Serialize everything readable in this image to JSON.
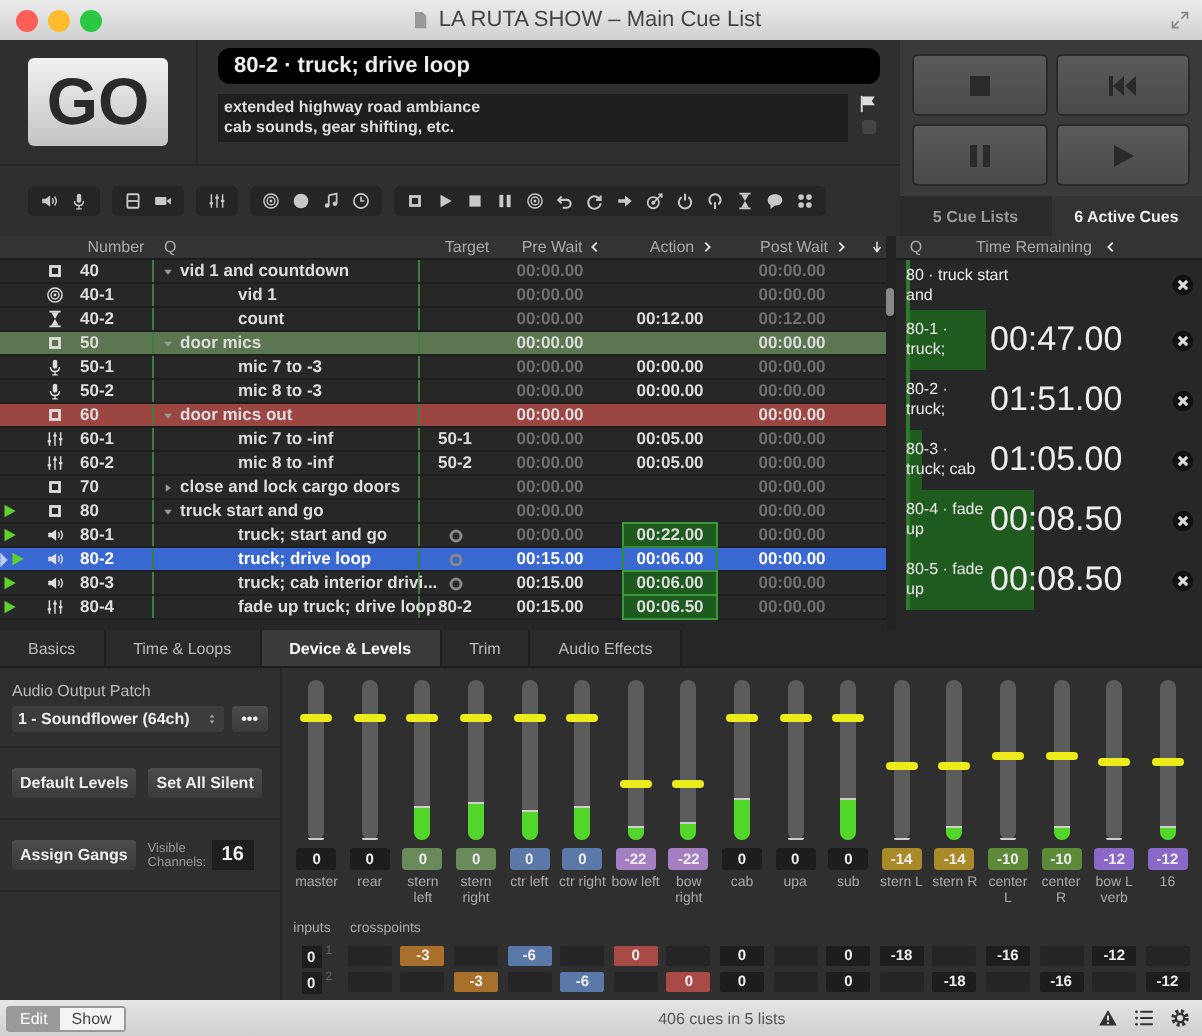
{
  "window": {
    "title": "LA RUTA SHOW – Main Cue List"
  },
  "go_button": {
    "label": "GO"
  },
  "current_cue": {
    "title": "80-2 · truck; drive loop",
    "notes": [
      "extended highway road ambiance",
      "cab sounds, gear shifting, etc."
    ]
  },
  "panel_tabs": [
    {
      "label": "5 Cue Lists",
      "selected": false
    },
    {
      "label": "6 Active Cues",
      "selected": true
    }
  ],
  "cue_list": {
    "columns": [
      "Number",
      "Q",
      "Target",
      "Pre Wait",
      "Action",
      "Post Wait"
    ],
    "cues": [
      {
        "number": "40",
        "kind": "group",
        "name": "vid 1 and countdown",
        "expanded": true,
        "selected": false,
        "running": false,
        "pre_wait": {
          "text": "00:00.00",
          "dim": true
        },
        "post_wait": {
          "text": "00:00.00",
          "dim": true
        },
        "children": [
          {
            "number": "40-1",
            "kind": "video",
            "name": "vid 1",
            "selected": false,
            "running": false,
            "pre_wait": {
              "text": "00:00.00",
              "dim": true
            },
            "post_wait": {
              "text": "00:00.00",
              "dim": true
            }
          },
          {
            "number": "40-2",
            "kind": "wait",
            "name": "count",
            "selected": false,
            "running": false,
            "pre_wait": {
              "text": "00:00.00",
              "dim": true
            },
            "action": {
              "text": "00:12.00",
              "dim": false
            },
            "post_wait": {
              "text": "00:12.00",
              "dim": true
            }
          }
        ]
      },
      {
        "number": "50",
        "kind": "group",
        "name": "door mics",
        "color": "#5b7650",
        "expanded": true,
        "selected": false,
        "running": false,
        "pre_wait": {
          "text": "00:00.00",
          "dim": false
        },
        "post_wait": {
          "text": "00:00.00",
          "dim": false
        },
        "children": [
          {
            "number": "50-1",
            "kind": "mic",
            "name": "mic 7 to -3",
            "selected": false,
            "running": false,
            "pre_wait": {
              "text": "00:00.00",
              "dim": true
            },
            "action": {
              "text": "00:00.00",
              "dim": false
            },
            "post_wait": {
              "text": "00:00.00",
              "dim": true
            }
          },
          {
            "number": "50-2",
            "kind": "mic",
            "name": "mic 8 to -3",
            "selected": false,
            "running": false,
            "pre_wait": {
              "text": "00:00.00",
              "dim": true
            },
            "action": {
              "text": "00:00.00",
              "dim": false
            },
            "post_wait": {
              "text": "00:00.00",
              "dim": true
            }
          }
        ]
      },
      {
        "number": "60",
        "kind": "group",
        "name": "door mics out",
        "color": "#9c4643",
        "expanded": true,
        "selected": false,
        "running": false,
        "pre_wait": {
          "text": "00:00.00",
          "dim": false
        },
        "post_wait": {
          "text": "00:00.00",
          "dim": false
        },
        "children": [
          {
            "number": "60-1",
            "kind": "fade",
            "name": "mic 7 to -inf",
            "target": "50-1",
            "selected": false,
            "running": false,
            "pre_wait": {
              "text": "00:00.00",
              "dim": true
            },
            "action": {
              "text": "00:05.00",
              "dim": false
            },
            "post_wait": {
              "text": "00:00.00",
              "dim": true
            }
          },
          {
            "number": "60-2",
            "kind": "fade",
            "name": "mic 8 to -inf",
            "target": "50-2",
            "selected": false,
            "running": false,
            "pre_wait": {
              "text": "00:00.00",
              "dim": true
            },
            "action": {
              "text": "00:05.00",
              "dim": false
            },
            "post_wait": {
              "text": "00:00.00",
              "dim": true
            }
          }
        ]
      },
      {
        "number": "70",
        "kind": "group",
        "name": "close and lock cargo doors",
        "expanded": false,
        "selected": false,
        "running": false,
        "pre_wait": {
          "text": "00:00.00",
          "dim": true
        },
        "post_wait": {
          "text": "00:00.00",
          "dim": true
        }
      },
      {
        "number": "80",
        "kind": "group",
        "name": "truck start and go",
        "expanded": true,
        "selected": false,
        "running": true,
        "pre_wait": {
          "text": "00:00.00",
          "dim": true
        },
        "post_wait": {
          "text": "00:00.00",
          "dim": true
        },
        "children": [
          {
            "number": "80-1",
            "kind": "audio",
            "name": "truck; start and go",
            "selected": false,
            "running": true,
            "pre_wait": {
              "text": "00:00.00",
              "dim": true
            },
            "action": {
              "text": "00:22.00",
              "dim": false
            },
            "post_wait": {
              "text": "00:00.00",
              "dim": true
            }
          },
          {
            "number": "80-2",
            "kind": "audio",
            "name": "truck; drive loop",
            "selected": true,
            "running": true,
            "pre_wait": {
              "text": "00:15.00",
              "dim": false
            },
            "action": {
              "text": "00:06.00",
              "dim": false
            },
            "post_wait": {
              "text": "00:00.00",
              "dim": false
            }
          },
          {
            "number": "80-3",
            "kind": "audio",
            "name": "truck; cab interior drivi...",
            "selected": false,
            "running": true,
            "pre_wait": {
              "text": "00:15.00",
              "dim": false
            },
            "action": {
              "text": "00:06.00",
              "dim": false
            },
            "post_wait": {
              "text": "00:00.00",
              "dim": true
            }
          },
          {
            "number": "80-4",
            "kind": "fade",
            "name": "fade up truck; drive loop",
            "target": "80-2",
            "selected": false,
            "running": true,
            "pre_wait": {
              "text": "00:15.00",
              "dim": false
            },
            "action": {
              "text": "00:06.50",
              "dim": false
            },
            "post_wait": {
              "text": "00:00.00",
              "dim": true
            }
          }
        ]
      }
    ]
  },
  "active_cues": {
    "columns": [
      "Q",
      "Time Remaining"
    ],
    "items": [
      {
        "name": "80 · truck start and",
        "level": 0
      },
      {
        "name": "80-1 · truck;",
        "time": "00:47.00",
        "level": 0.26
      },
      {
        "name": "80-2 · truck;",
        "time": "01:51.00",
        "level": 0
      },
      {
        "name": "80-3 · truck; cab",
        "time": "01:05.00",
        "level": 0.04
      },
      {
        "name": "80-4 · fade up",
        "time": "00:08.50",
        "level": 0.42
      },
      {
        "name": "80-5 · fade up",
        "time": "00:08.50",
        "level": 0.42
      }
    ]
  },
  "inspector": {
    "tabs": [
      {
        "label": "Basics",
        "selected": false
      },
      {
        "label": "Time & Loops",
        "selected": false
      },
      {
        "label": "Device & Levels",
        "selected": true
      },
      {
        "label": "Trim",
        "selected": false
      },
      {
        "label": "Audio Effects",
        "selected": false
      }
    ],
    "output_patch_label": "Audio Output Patch",
    "output_patch": "1 - Soundflower (64ch)",
    "more_button": "•••",
    "buttons": [
      "Default Levels",
      "Set All Silent"
    ],
    "assign_gangs": "Assign Gangs",
    "visible_channels_label": "Visible Channels:",
    "visible_channels": "16",
    "channels": [
      {
        "label": "master",
        "value": "0",
        "fader": {
          "level": 0.77
        },
        "meter": {
          "level": 0
        }
      },
      {
        "label": "rear",
        "value": "0",
        "fader": {
          "level": 0.77
        },
        "meter": {
          "level": 0
        }
      },
      {
        "label": "stern left",
        "value": "0",
        "color": "#6a8a5c",
        "fader": {
          "level": 0.77
        },
        "meter": {
          "level": 0.2
        }
      },
      {
        "label": "stern right",
        "value": "0",
        "color": "#6a8a5c",
        "fader": {
          "level": 0.77
        },
        "meter": {
          "level": 0.23
        }
      },
      {
        "label": "ctr left",
        "value": "0",
        "color": "#5a78a8",
        "fader": {
          "level": 0.77
        },
        "meter": {
          "level": 0.18
        }
      },
      {
        "label": "ctr right",
        "value": "0",
        "color": "#5a78a8",
        "fader": {
          "level": 0.77
        },
        "meter": {
          "level": 0.2
        }
      },
      {
        "label": "bow left",
        "value": "-22",
        "color": "#a47fc2",
        "fader": {
          "level": 0.36
        },
        "meter": {
          "level": 0.08
        }
      },
      {
        "label": "bow right",
        "value": "-22",
        "color": "#a47fc2",
        "fader": {
          "level": 0.36
        },
        "meter": {
          "level": 0.1
        }
      },
      {
        "label": "cab",
        "value": "0",
        "fader": {
          "level": 0.77
        },
        "meter": {
          "level": 0.25
        }
      },
      {
        "label": "upa",
        "value": "0",
        "fader": {
          "level": 0.77
        },
        "meter": {
          "level": 0
        }
      },
      {
        "label": "sub",
        "value": "0",
        "fader": {
          "level": 0.77
        },
        "meter": {
          "level": 0.25
        }
      },
      {
        "label": "stern L",
        "value": "-14",
        "color": "#a88a28",
        "fader": {
          "level": 0.47
        },
        "meter": {
          "level": 0
        }
      },
      {
        "label": "stern R",
        "value": "-14",
        "color": "#a88a28",
        "fader": {
          "level": 0.47
        },
        "meter": {
          "level": 0.07
        }
      },
      {
        "label": "center L",
        "value": "-10",
        "color": "#5d8a38",
        "fader": {
          "level": 0.54
        },
        "meter": {
          "level": 0
        }
      },
      {
        "label": "center R",
        "value": "-10",
        "color": "#5d8a38",
        "fader": {
          "level": 0.54
        },
        "meter": {
          "level": 0.08
        }
      },
      {
        "label": "bow L verb",
        "value": "-12",
        "color": "#8a68c8",
        "fader": {
          "level": 0.5
        },
        "meter": {
          "level": 0
        }
      },
      {
        "label": "16",
        "value": "-12",
        "color": "#8a68c8",
        "fader": {
          "level": 0.5
        },
        "meter": {
          "level": 0.08
        }
      }
    ],
    "inputs_label": "inputs",
    "crosspoints_label": "crosspoints",
    "crosspoints": [
      {
        "input": "0",
        "number": "1",
        "cells": [
          null,
          {
            "text": "-3",
            "color": "#a8702a"
          },
          null,
          {
            "text": "-6",
            "color": "#5a78a8"
          },
          null,
          {
            "text": "0",
            "color": "#a84a46"
          },
          null,
          {
            "text": "0"
          },
          null,
          {
            "text": "0"
          },
          {
            "text": "-18"
          },
          null,
          {
            "text": "-16"
          },
          null,
          {
            "text": "-12"
          },
          null
        ]
      },
      {
        "input": "0",
        "number": "2",
        "cells": [
          null,
          null,
          {
            "text": "-3",
            "color": "#a8702a"
          },
          null,
          {
            "text": "-6",
            "color": "#5a78a8"
          },
          null,
          {
            "text": "0",
            "color": "#a84a46"
          },
          {
            "text": "0"
          },
          null,
          {
            "text": "0"
          },
          null,
          {
            "text": "-18"
          },
          null,
          {
            "text": "-16"
          },
          null,
          {
            "text": "-12"
          }
        ]
      }
    ]
  },
  "status_bar": {
    "modes": [
      {
        "label": "Edit",
        "selected": true
      },
      {
        "label": "Show",
        "selected": false
      }
    ],
    "text": "406 cues in 5 lists"
  }
}
